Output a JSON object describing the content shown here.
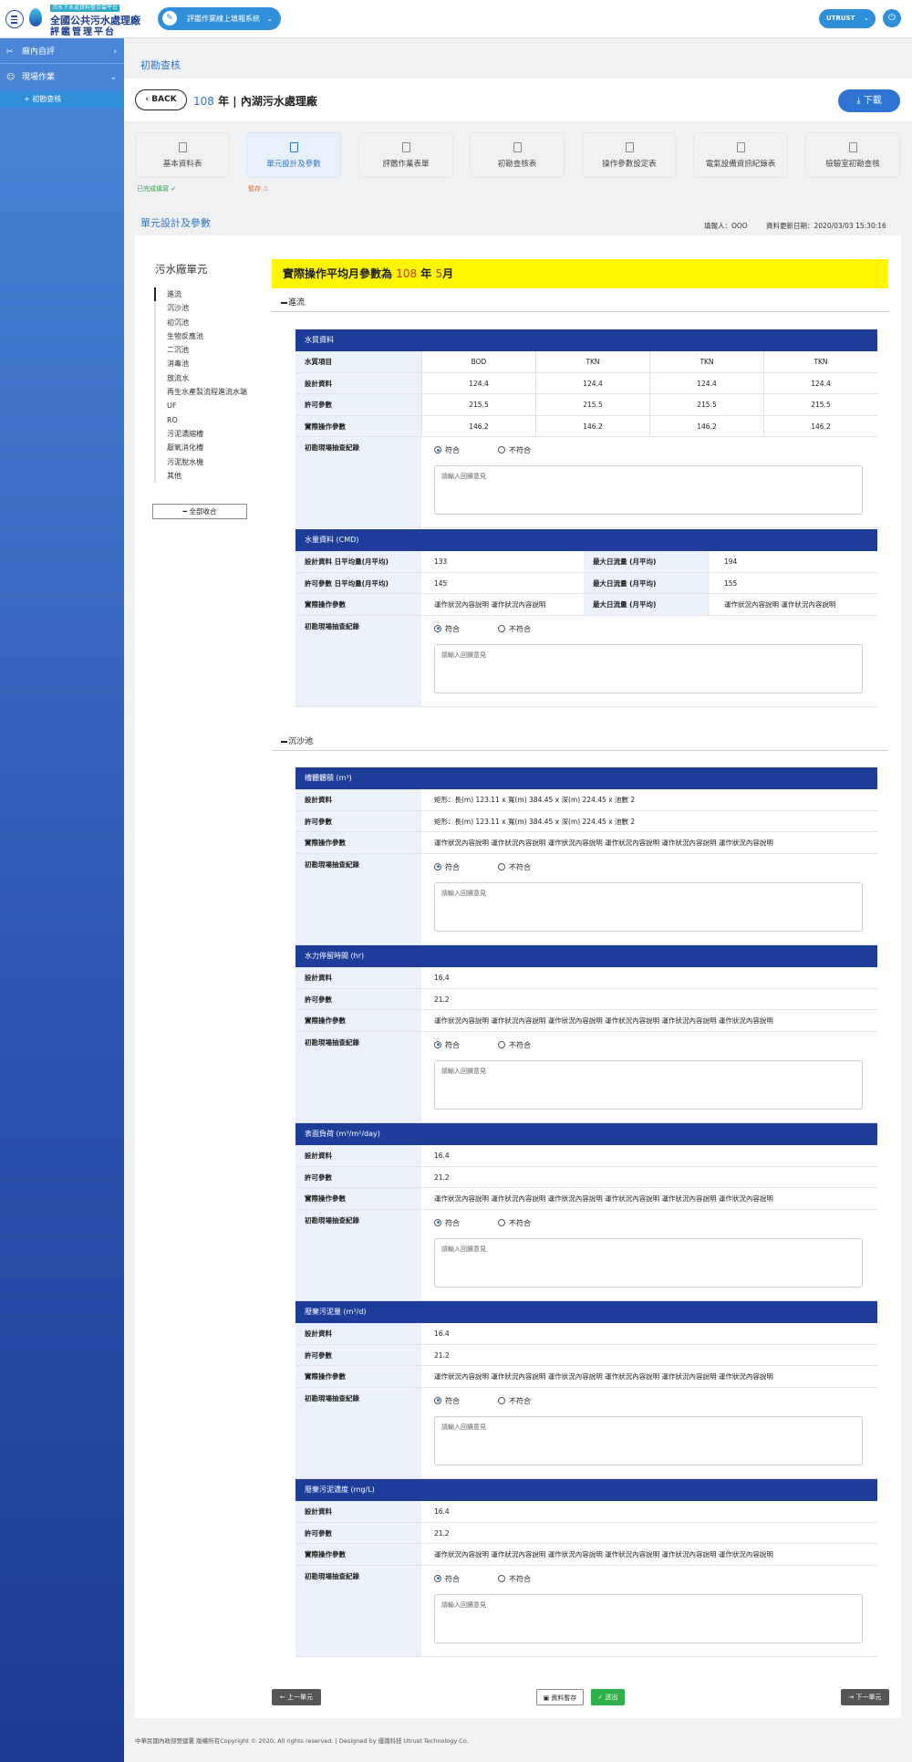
{
  "header": {
    "logo_small": "污水下水道資料整合雲平台",
    "logo_line1": "全國公共污水處理廠",
    "logo_line2": "評鑑管理平台",
    "system_label": "評鑑作業線上填報系統",
    "user_label": "UTRUST"
  },
  "sidebar": {
    "items": [
      {
        "label": "廠內自評",
        "icon": "wrench-icon"
      },
      {
        "label": "現場作業",
        "icon": "people-icon"
      }
    ],
    "sub_item": "+ 初勘查核"
  },
  "page": {
    "breadcrumb": "初勘查核",
    "back_label": "BACK",
    "year": "108",
    "year_suffix": "年",
    "plant": "| 內湖污水處理廠",
    "download_label": "下載"
  },
  "tabs": [
    {
      "label": "基本資料表"
    },
    {
      "label": "單元設計及參數"
    },
    {
      "label": "評鑑作業表單"
    },
    {
      "label": "初勘查核表"
    },
    {
      "label": "操作參數設定表"
    },
    {
      "label": "電氣設備資訊紀錄表"
    },
    {
      "label": "檢驗室初勘查核"
    }
  ],
  "tab_status": {
    "done": "已完成填寫 ✓",
    "draft": "暫存 ⚠",
    "done_color": "#2e9e44",
    "draft_color": "#e06a1b"
  },
  "section": {
    "title": "單元設計及參數",
    "filler": "填報人：OOO",
    "updated": "資料更新日期：2020/03/03 15:30:16"
  },
  "units": {
    "title": "污水廠單元",
    "items": [
      "進流",
      "沉沙池",
      "初沉池",
      "生物反應池",
      "二沉池",
      "消毒池",
      "放流水",
      "再生水產製流程進流水端",
      "UF",
      "RO",
      "污泥濃縮槽",
      "厭氧消化槽",
      "污泥脫水機",
      "其他"
    ],
    "collapse_label": "━ 全部收合"
  },
  "banner": {
    "prefix": "實際操作平均月參數為",
    "year": "108",
    "mid": "年",
    "month": "5",
    "suffix": "月"
  },
  "groups": {
    "inflow": "進流",
    "grit": "沉沙池"
  },
  "common": {
    "comply": "符合",
    "noncomply": "不符合",
    "placeholder": "請輸入回饋意見",
    "check_label": "初勘現場抽查紀錄",
    "op_text": "運作狀況內容說明 運作狀況內容說明 運作狀況內容說明 運作狀況內容說明 運作狀況內容說明 運作狀況內容說明",
    "short_op": "運作狀況內容說明 運作狀況內容說明"
  },
  "water_quality": {
    "title": "水質資料",
    "rows": [
      {
        "label": "水質項目",
        "values": [
          "BOD",
          "TKN",
          "TKN",
          "TKN"
        ]
      },
      {
        "label": "設計資料",
        "values": [
          "124.4",
          "124.4",
          "124.4",
          "124.4"
        ]
      },
      {
        "label": "許可參數",
        "values": [
          "215.5",
          "215.5",
          "215.5",
          "215.5"
        ]
      },
      {
        "label": "實際操作參數",
        "values": [
          "146.2",
          "146.2",
          "146.2",
          "146.2"
        ]
      }
    ]
  },
  "water_quantity": {
    "title": "水量資料 (CMD)",
    "rows": [
      {
        "label": "設計資料 日平均量(月平均)",
        "v1": "133",
        "label2": "最大日流量 (月平均)",
        "v2": "194"
      },
      {
        "label": "許可參數 日平均量(月平均)",
        "v1": "145",
        "label2": "最大日流量 (月平均)",
        "v2": "155"
      },
      {
        "label": "實際操作參數",
        "v1": "運作狀況內容說明 運作狀況內容說明",
        "label2": "最大日流量 (月平均)",
        "v2": "運作狀況內容說明 運作狀況內容說明"
      }
    ]
  },
  "grit_blocks": [
    {
      "title": "槽體體積 (m³)",
      "design": "矩形：長(m) 123.11 x 寬(m) 384.45 x 深(m) 224.45 x 池數 2",
      "permit": "矩形：長(m) 123.11 x 寬(m) 384.45 x 深(m) 224.45 x 池數 2"
    },
    {
      "title": "水力停留時間 (hr)",
      "design": "16.4",
      "permit": "21.2"
    },
    {
      "title": "表面負荷 (m³/m²/day)",
      "design": "16.4",
      "permit": "21.2"
    },
    {
      "title": "廢棄污泥量 (m³/d)",
      "design": "16.4",
      "permit": "21.2"
    },
    {
      "title": "廢棄污泥濃度 (mg/L)",
      "design": "16.4",
      "permit": "21.2"
    }
  ],
  "row_labels": {
    "design": "設計資料",
    "permit": "許可參數",
    "actual": "實際操作參數"
  },
  "buttons": {
    "prev": "← 上一單元",
    "save": "資料暫存",
    "submit": "✓ 送出",
    "next": "→ 下一單元"
  },
  "footer": "中華民國內政部營建署 版權所有Copyright © 2020, All rights reserved.   |   Designed by 優識科技 Utrust Technology Co.",
  "colors": {
    "accent": "#2f74c5",
    "header_bar": "#1e3d9b",
    "banner": "#fff500"
  }
}
